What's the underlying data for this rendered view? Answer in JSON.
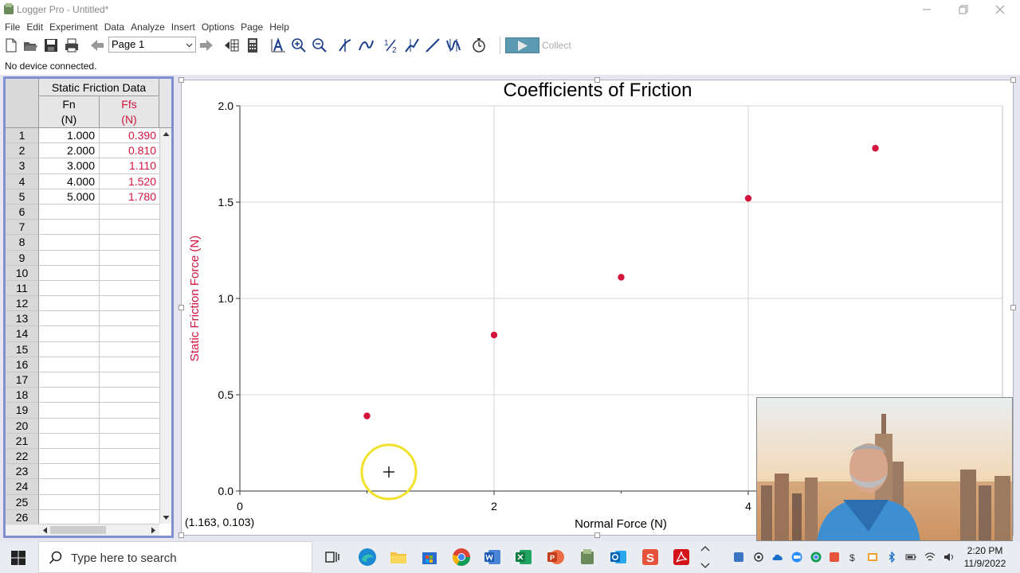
{
  "window": {
    "title": "Logger Pro - Untitled*"
  },
  "menu": [
    "File",
    "Edit",
    "Experiment",
    "Data",
    "Analyze",
    "Insert",
    "Options",
    "Page",
    "Help"
  ],
  "toolbar": {
    "page_select": "Page 1",
    "collect_label": "Collect"
  },
  "status": "No device connected.",
  "table": {
    "title": "Static Friction Data",
    "col1": {
      "name": "Fn",
      "unit": "(N)"
    },
    "col2": {
      "name": "Ffs",
      "unit": "(N)"
    },
    "row_numbers": [
      "1",
      "2",
      "3",
      "4",
      "5",
      "6",
      "7",
      "8",
      "9",
      "10",
      "11",
      "12",
      "13",
      "14",
      "15",
      "16",
      "17",
      "18",
      "19",
      "20",
      "21",
      "22",
      "23",
      "24",
      "25",
      "26"
    ],
    "fn": [
      "1.000",
      "2.000",
      "3.000",
      "4.000",
      "5.000"
    ],
    "ffs": [
      "0.390",
      "0.810",
      "1.110",
      "1.520",
      "1.780"
    ]
  },
  "chart_data": {
    "type": "scatter",
    "title": "Coefficients of Friction",
    "xlabel": "Normal Force (N)",
    "ylabel": "Static Friction Force (N)",
    "x": [
      1,
      2,
      3,
      4,
      5
    ],
    "y": [
      0.39,
      0.81,
      1.11,
      1.52,
      1.78
    ],
    "xlim": [
      0,
      6
    ],
    "ylim": [
      0,
      2
    ],
    "xticks": [
      "0",
      "2",
      "4"
    ],
    "yticks": [
      "0.0",
      "0.5",
      "1.0",
      "1.5",
      "2.0"
    ],
    "grid": true,
    "point_color": "#d3143c"
  },
  "graph": {
    "coord_readout": "(1.163, 0.103)"
  },
  "taskbar": {
    "search_placeholder": "Type here to search",
    "time": "2:20 PM",
    "date": "11/9/2022"
  }
}
